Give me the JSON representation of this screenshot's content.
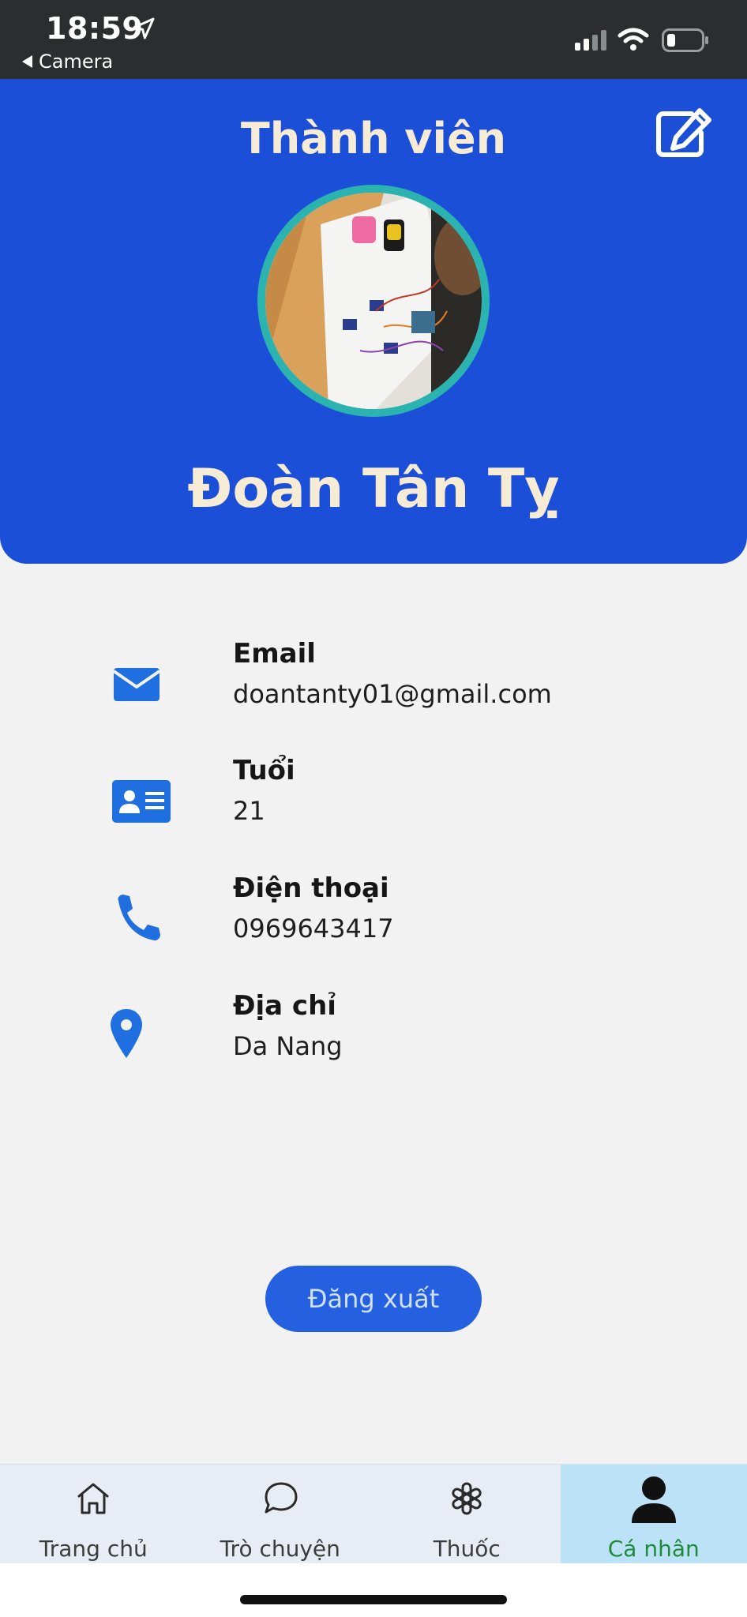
{
  "status_bar": {
    "time": "18:59",
    "back_label": "Camera"
  },
  "header": {
    "title": "Thành viên",
    "user_name": "Đoàn Tân Tỵ"
  },
  "info": [
    {
      "icon": "envelope-icon",
      "label": "Email",
      "value": "doantanty01@gmail.com"
    },
    {
      "icon": "id-card-icon",
      "label": "Tuổi",
      "value": "21"
    },
    {
      "icon": "phone-icon",
      "label": "Điện thoại",
      "value": "0969643417"
    },
    {
      "icon": "map-pin-icon",
      "label": "Địa chỉ",
      "value": "Da Nang"
    }
  ],
  "logout_label": "Đăng xuất",
  "tabs": [
    {
      "icon": "home-icon",
      "label": "Trang chủ",
      "active": false
    },
    {
      "icon": "chat-bubble-icon",
      "label": "Trò chuyện",
      "active": false
    },
    {
      "icon": "medicine-icon",
      "label": "Thuốc",
      "active": false
    },
    {
      "icon": "person-icon",
      "label": "Cá nhân",
      "active": true
    }
  ],
  "colors": {
    "header": "#1c4fd8",
    "header_text": "#f6ebd4",
    "icon_blue": "#1f6fe0",
    "button": "#2560e0",
    "active_tab_bg": "#bce2f8",
    "active_tab_text": "#1f8a3a"
  }
}
